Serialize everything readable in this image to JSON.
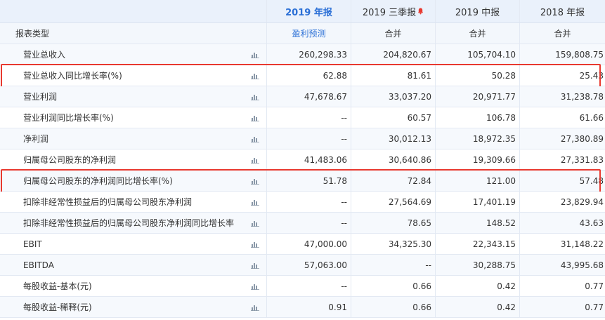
{
  "header": {
    "label_col": "",
    "periods": [
      {
        "label": "2019 年报",
        "active": true,
        "bell": false
      },
      {
        "label": "2019 三季报",
        "active": false,
        "bell": true
      },
      {
        "label": "2019 中报",
        "active": false,
        "bell": false
      },
      {
        "label": "2018 年报",
        "active": false,
        "bell": false
      }
    ]
  },
  "report_type": {
    "label": "报表类型",
    "values": [
      "盈利预测",
      "合并",
      "合并",
      "合并"
    ]
  },
  "rows": [
    {
      "label": "营业总收入",
      "values": [
        "260,298.33",
        "204,820.67",
        "105,704.10",
        "159,808.75"
      ],
      "highlighted": false
    },
    {
      "label": "营业总收入同比增长率(%)",
      "values": [
        "62.88",
        "81.61",
        "50.28",
        "25.43"
      ],
      "highlighted": true
    },
    {
      "label": "营业利润",
      "values": [
        "47,678.67",
        "33,037.20",
        "20,971.77",
        "31,238.78"
      ],
      "highlighted": false
    },
    {
      "label": "营业利润同比增长率(%)",
      "values": [
        "--",
        "60.57",
        "106.78",
        "61.66"
      ],
      "highlighted": false
    },
    {
      "label": "净利润",
      "values": [
        "--",
        "30,012.13",
        "18,972.35",
        "27,380.89"
      ],
      "highlighted": false
    },
    {
      "label": "归属母公司股东的净利润",
      "values": [
        "41,483.06",
        "30,640.86",
        "19,309.66",
        "27,331.83"
      ],
      "highlighted": false
    },
    {
      "label": "归属母公司股东的净利润同比增长率(%)",
      "values": [
        "51.78",
        "72.84",
        "121.00",
        "57.48"
      ],
      "highlighted": true
    },
    {
      "label": "扣除非经常性损益后的归属母公司股东净利润",
      "values": [
        "--",
        "27,564.69",
        "17,401.19",
        "23,829.94"
      ],
      "highlighted": false
    },
    {
      "label": "扣除非经常性损益后的归属母公司股东净利润同比增长率",
      "values": [
        "--",
        "78.65",
        "148.52",
        "43.63"
      ],
      "highlighted": false
    },
    {
      "label": "EBIT",
      "values": [
        "47,000.00",
        "34,325.30",
        "22,343.15",
        "31,148.22"
      ],
      "highlighted": false
    },
    {
      "label": "EBITDA",
      "values": [
        "57,063.00",
        "--",
        "30,288.75",
        "43,995.68"
      ],
      "highlighted": false
    },
    {
      "label": "每股收益-基本(元)",
      "values": [
        "--",
        "0.66",
        "0.42",
        "0.77"
      ],
      "highlighted": false
    },
    {
      "label": "每股收益-稀释(元)",
      "values": [
        "0.91",
        "0.66",
        "0.42",
        "0.77"
      ],
      "highlighted": false
    }
  ],
  "colors": {
    "accent": "#2a6fd6",
    "highlight_border": "#e8392f",
    "header_bg": "#eaf1fb",
    "alt_row_bg": "#f6f9fd",
    "bell": "#e8392f",
    "chart_icon": "#8a98a8"
  },
  "icons": {
    "row_chart": "bar-chart-icon",
    "notification": "bell-icon"
  }
}
